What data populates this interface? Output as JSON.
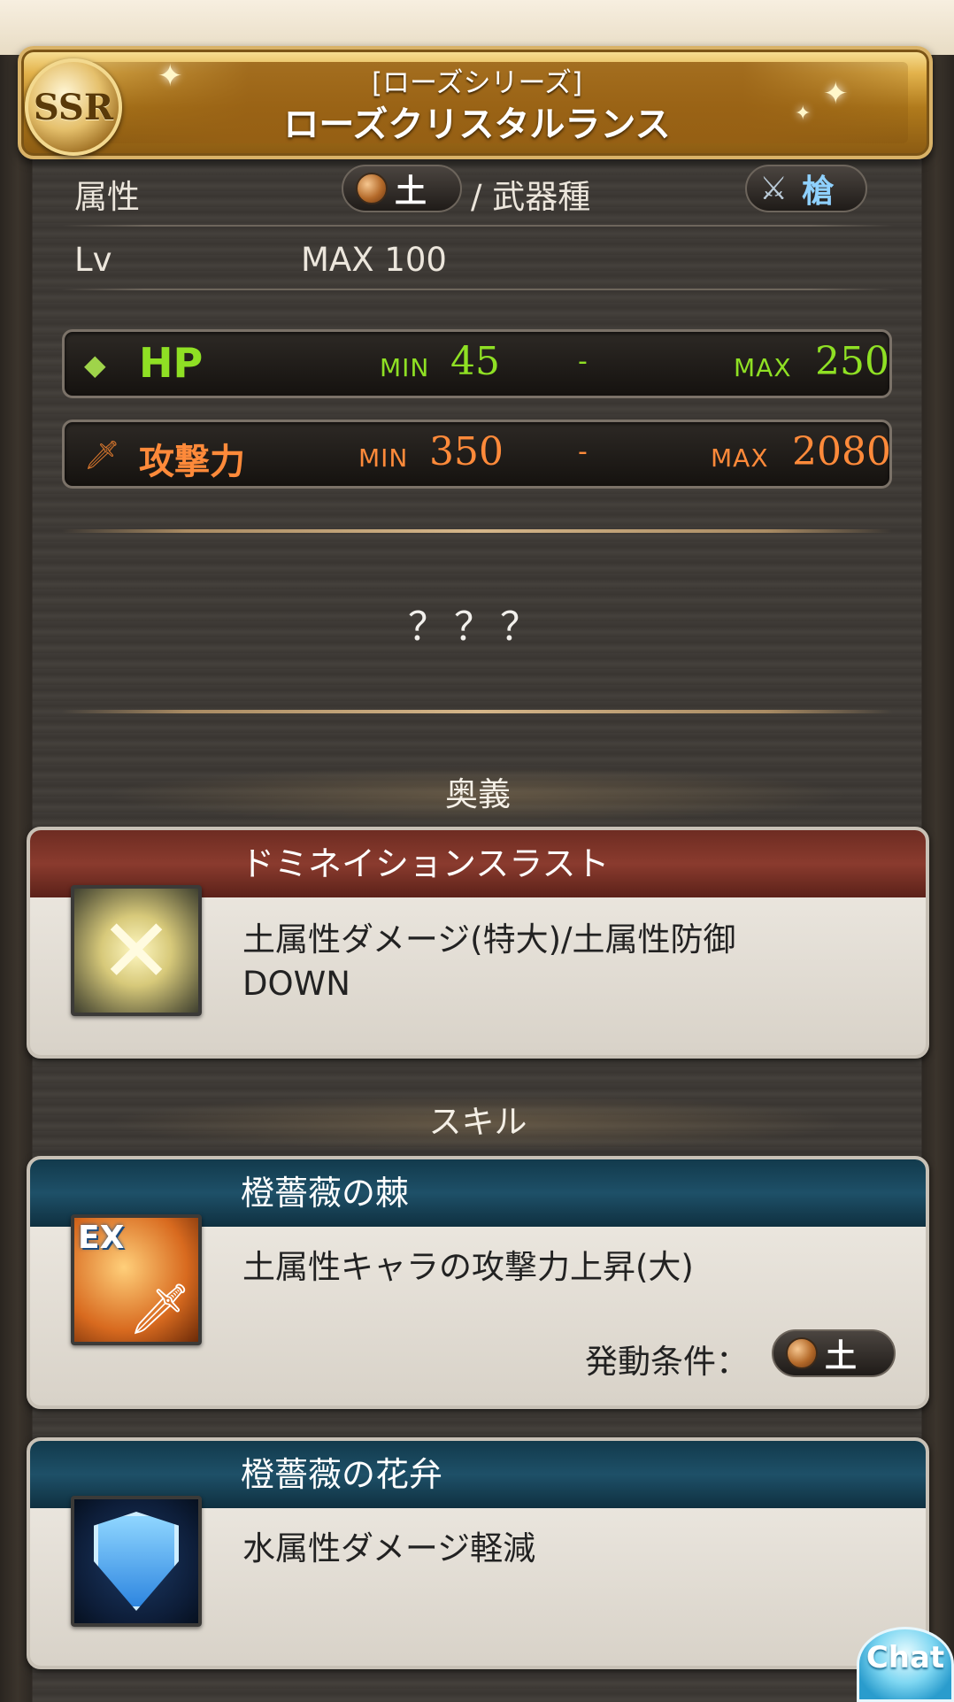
{
  "header": {
    "rarity": "SSR",
    "series": "[ローズシリーズ]",
    "name": "ローズクリスタルランス"
  },
  "attributes": {
    "element_label": "属性",
    "element_value": "土",
    "weapon_type_label": "/ 武器種",
    "weapon_type_value": "槍",
    "level_label": "Lv",
    "level_value": "MAX 100"
  },
  "stats": {
    "hp": {
      "label": "HP",
      "min_label": "MIN",
      "min": "45",
      "sep": "-",
      "max_label": "MAX",
      "max": "250"
    },
    "atk": {
      "label": "攻撃力",
      "min_label": "MIN",
      "min": "350",
      "sep": "-",
      "max_label": "MAX",
      "max": "2080"
    }
  },
  "unknown_text": "？？？",
  "ougi": {
    "section_title": "奥義",
    "name": "ドミネイションスラスト",
    "desc_line1": "土属性ダメージ(特大)/土属性防御",
    "desc_line2": "DOWN"
  },
  "skills": {
    "section_title": "スキル",
    "items": [
      {
        "name": "橙薔薇の棘",
        "desc": "土属性キャラの攻撃力上昇(大)",
        "icon_tag": "EX",
        "condition_label": "発動条件：",
        "condition_value": "土"
      },
      {
        "name": "橙薔薇の花弁",
        "desc": "水属性ダメージ軽減"
      }
    ]
  },
  "chat_button": "Chat",
  "colors": {
    "hp": "#8fe024",
    "atk": "#ff8a3a",
    "ougi_header": "#8a3b2e",
    "skill_header": "#1e5068"
  }
}
